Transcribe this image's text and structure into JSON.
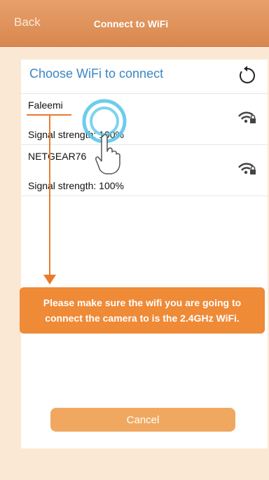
{
  "header": {
    "back_label": "Back",
    "title": "Connect to WiFi"
  },
  "panel": {
    "title": "Choose WiFi to connect",
    "refresh_icon": "refresh-icon"
  },
  "networks": [
    {
      "name": "Faleemi",
      "signal": "Signal strength: 100%",
      "icon": "wifi-lock-icon"
    },
    {
      "name": "NETGEAR76",
      "signal": "Signal strength: 100%",
      "icon": "wifi-lock-icon"
    }
  ],
  "note": "Please make sure the wifi you are going to connect the camera to is the 2.4GHz WiFi.",
  "cancel_label": "Cancel",
  "colors": {
    "header": "#d7874f",
    "accent": "#ef8a37",
    "title_blue": "#3a86c4",
    "background": "#fbe8d4"
  }
}
